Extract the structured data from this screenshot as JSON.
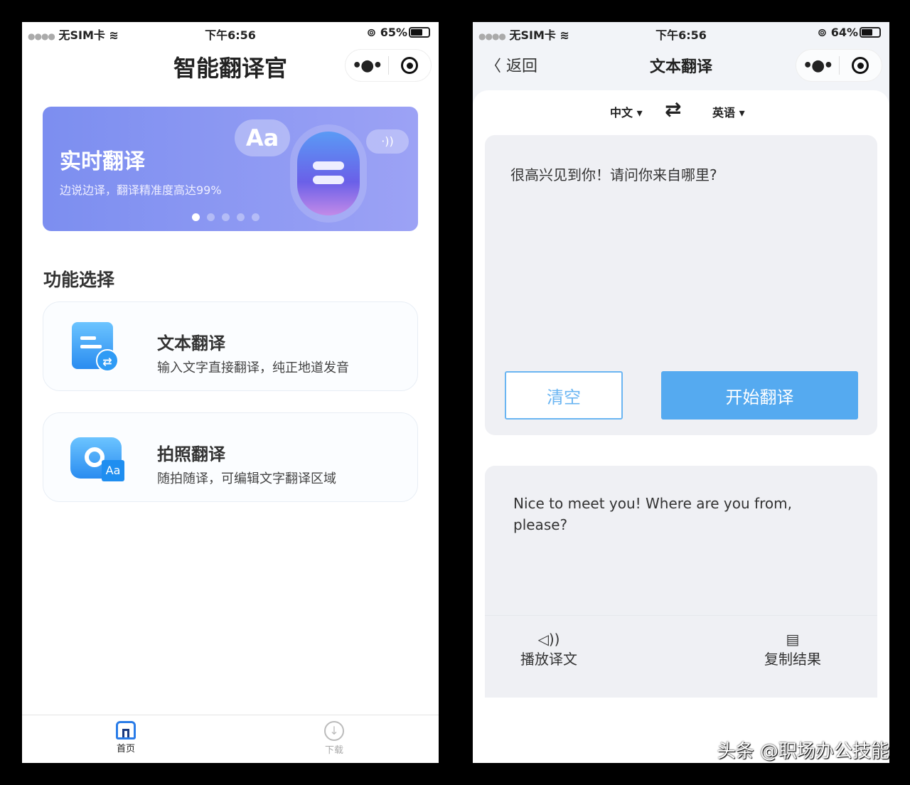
{
  "left": {
    "status": {
      "carrier": "无SIM卡",
      "time": "下午6:56",
      "battery": "65%",
      "battery_level": 0.65
    },
    "title": "智能翻译官",
    "banner": {
      "title": "实时翻译",
      "subtitle": "边说边译，翻译精准度高达99%",
      "badge": "Aa",
      "pages": 5,
      "active_page": 1
    },
    "section_title": "功能选择",
    "features": [
      {
        "title": "文本翻译",
        "desc": "输入文字直接翻译，纯正地道发音",
        "icon": "document-translate-icon"
      },
      {
        "title": "拍照翻译",
        "desc": "随拍随译，可编辑文字翻译区域",
        "icon": "camera-translate-icon",
        "badge": "Aa"
      }
    ],
    "tabs": [
      {
        "label": "首页",
        "icon": "home-icon",
        "active": true
      },
      {
        "label": "下载",
        "icon": "download-icon",
        "active": false
      }
    ]
  },
  "right": {
    "status": {
      "carrier": "无SIM卡",
      "time": "下午6:56",
      "battery": "64%",
      "battery_level": 0.64
    },
    "back": "返回",
    "title": "文本翻译",
    "source_lang": "中文",
    "target_lang": "英语",
    "input_text": "很高兴见到你！请问你来自哪里?",
    "clear": "清空",
    "translate": "开始翻译",
    "output_text": "Nice to meet you! Where are you from, please?",
    "play": "播放译文",
    "copy": "复制结果",
    "watermark": "头条 @职场办公技能"
  },
  "colors": {
    "accent": "#55aaf0",
    "banner": "#8a98f2"
  }
}
